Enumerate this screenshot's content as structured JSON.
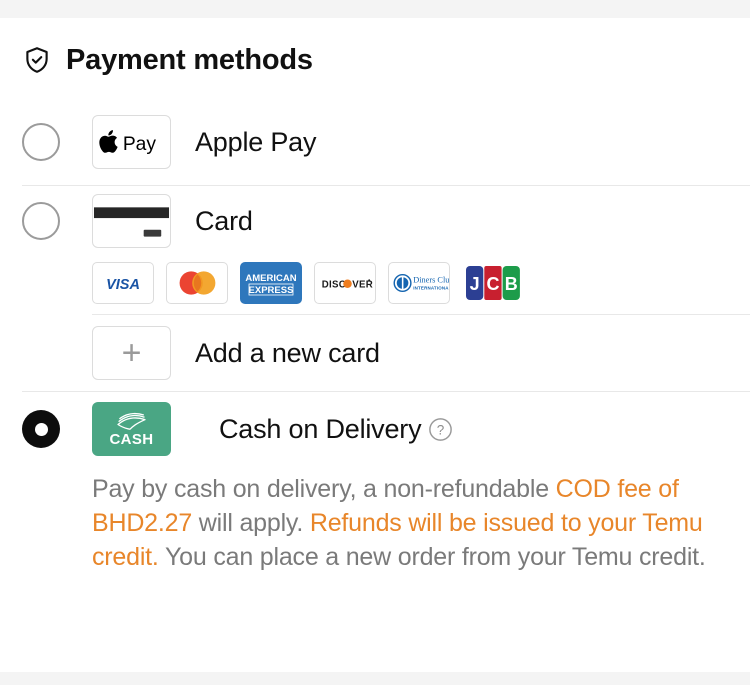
{
  "colors": {
    "page_background": "#f4f4f4",
    "panel_background": "#ffffff",
    "accent_orange": "#e8862a",
    "cash_green": "#4aa684",
    "divider": "#e8e8e8",
    "body_text": "#7a7a7a",
    "title_text": "#111111"
  },
  "header": {
    "title": "Payment methods",
    "icon": "shield-check-icon"
  },
  "methods": [
    {
      "id": "apple-pay",
      "label": "Apple Pay",
      "selected": false,
      "logo": "apple-pay-logo",
      "logo_text": "Pay"
    },
    {
      "id": "card",
      "label": "Card",
      "selected": false,
      "logo": "credit-card-icon"
    },
    {
      "id": "cash-on-delivery",
      "label": "Cash on Delivery",
      "selected": true,
      "logo": "cash-icon",
      "logo_text": "CASH",
      "help_icon": "question-mark-circle-icon"
    }
  ],
  "card_networks": [
    {
      "id": "visa",
      "name": "VISA"
    },
    {
      "id": "mastercard",
      "name": "Mastercard"
    },
    {
      "id": "amex",
      "name": "AMERICAN EXPRESS",
      "line1": "AMERICAN",
      "line2": "EXPRESS"
    },
    {
      "id": "discover",
      "name": "DISCOVER",
      "pre": "DISC",
      "post": "VER"
    },
    {
      "id": "diners-club",
      "name": "Diners Club International",
      "line1": "Diners Club",
      "line2": "INTERNATIONAL"
    },
    {
      "id": "jcb",
      "name": "JCB",
      "l1": "J",
      "l2": "C",
      "l3": "B"
    }
  ],
  "add_card": {
    "label": "Add a new card",
    "icon": "plus-icon"
  },
  "cod_description": {
    "part1": "Pay by cash on delivery, a non-refundable ",
    "highlight1": "COD fee of BHD2.27",
    "part2": " will apply. ",
    "highlight2": "Refunds will be issued to your Temu credit.",
    "part3": " You can place a new order from your Temu credit."
  }
}
